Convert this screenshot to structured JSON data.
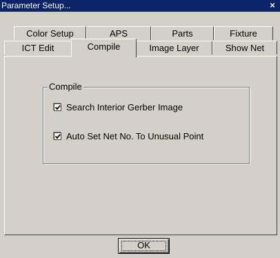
{
  "window": {
    "title": "Parameter Setup...",
    "close_label": "×"
  },
  "tabs": {
    "row1": [
      "Color Setup",
      "APS",
      "Parts",
      "Fixture"
    ],
    "row2": [
      "ICT Edit",
      "Compile",
      "Image Layer",
      "Show Net"
    ],
    "active": "Compile"
  },
  "compile_group": {
    "legend": "Compile",
    "options": [
      {
        "label": "Search Interior Gerber Image",
        "checked": true
      },
      {
        "label": "Auto Set Net No. To Unusual Point",
        "checked": true
      }
    ]
  },
  "buttons": {
    "ok": "OK"
  }
}
